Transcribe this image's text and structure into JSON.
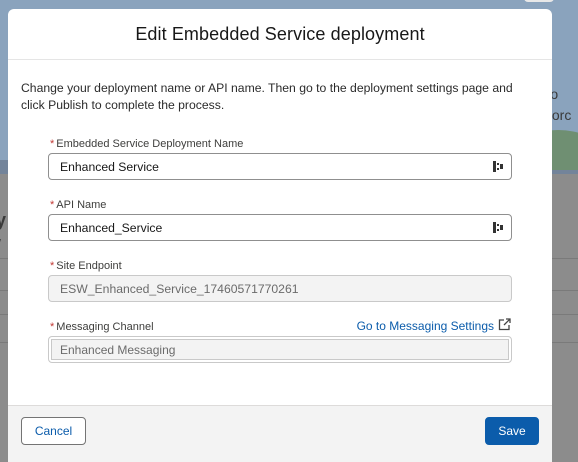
{
  "background": {
    "right_text_1": "r bo",
    "right_text_2": "forc",
    "left_text_1": "y",
    "left_text_2": "/"
  },
  "modal": {
    "title": "Edit Embedded Service deployment",
    "intro": "Change your deployment name or API name. Then go to the deployment settings page and click Publish to complete the process.",
    "fields": {
      "deployment_name": {
        "required_mark": "*",
        "label": "Embedded Service Deployment Name",
        "value": "Enhanced Service"
      },
      "api_name": {
        "required_mark": "*",
        "label": "API Name",
        "value": "Enhanced_Service"
      },
      "site_endpoint": {
        "required_mark": "*",
        "label": "Site Endpoint",
        "value": "ESW_Enhanced_Service_17460571770261"
      },
      "messaging_channel": {
        "required_mark": "*",
        "label": "Messaging Channel",
        "value": "Enhanced Messaging",
        "link_label": "Go to Messaging Settings"
      }
    },
    "footer": {
      "cancel_label": "Cancel",
      "save_label": "Save"
    }
  },
  "colors": {
    "brand": "#0b5cab",
    "required": "#c23934",
    "overlay": "#8c8c8c"
  },
  "icons": {
    "input_action": "password-manager-key-icon",
    "link_external": "external-link-icon"
  }
}
